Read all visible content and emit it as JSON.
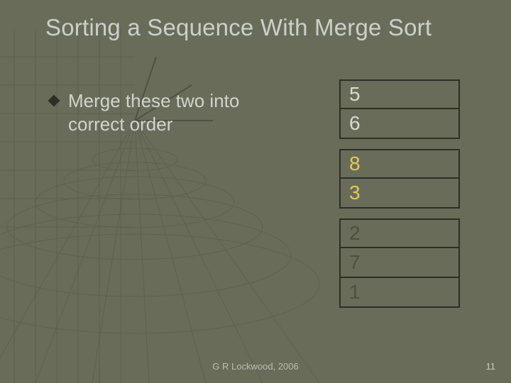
{
  "title": "Sorting a Sequence With Merge Sort",
  "bullet_text": "Merge these two into correct order",
  "groups": {
    "g1": [
      "5",
      "6"
    ],
    "g2": [
      "8",
      "3"
    ],
    "g3": [
      "2",
      "7",
      "1"
    ]
  },
  "footer": "G R Lockwood, 2006",
  "page_number": "11"
}
